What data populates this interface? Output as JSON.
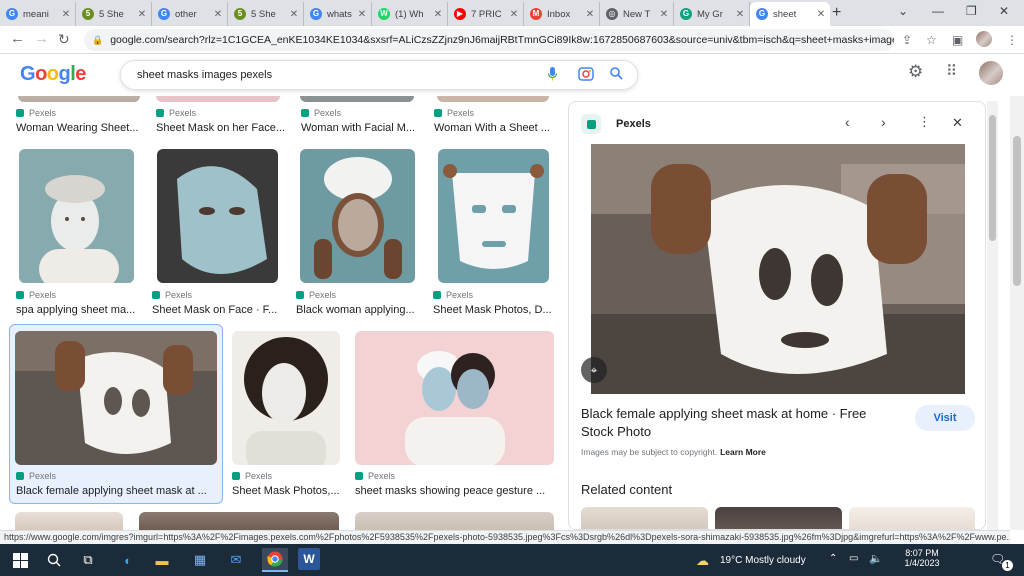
{
  "tabs": [
    {
      "title": "meani",
      "favicon": "G",
      "color": "#4285f4"
    },
    {
      "title": "5 She",
      "favicon": "5",
      "color": "#6b8e23"
    },
    {
      "title": "other",
      "favicon": "G",
      "color": "#4285f4"
    },
    {
      "title": "5 She",
      "favicon": "5",
      "color": "#6b8e23"
    },
    {
      "title": "whats",
      "favicon": "G",
      "color": "#4285f4"
    },
    {
      "title": "(1) Wh",
      "favicon": "W",
      "color": "#25d366"
    },
    {
      "title": "7 PRIC",
      "favicon": "▶",
      "color": "#ff0000"
    },
    {
      "title": "Inbox",
      "favicon": "M",
      "color": "#ea4335"
    },
    {
      "title": "New T",
      "favicon": "◎",
      "color": "#5f6368"
    },
    {
      "title": "My Gr",
      "favicon": "G",
      "color": "#10a37f"
    },
    {
      "title": "sheet",
      "favicon": "G",
      "color": "#4285f4"
    }
  ],
  "url": "google.com/search?rlz=1C1GCEA_enKE1034KE1034&sxsrf=ALiCzsZZjnz9nJ6maijRBtTmnGCi89Ik8w:1672850687603&source=univ&tbm=isch&q=sheet+masks+images...",
  "search_query": "sheet masks images pexels",
  "results_row0": [
    {
      "source": "Pexels",
      "caption": "Woman Wearing Sheet..."
    },
    {
      "source": "Pexels",
      "caption": "Sheet Mask on her Face..."
    },
    {
      "source": "Pexels",
      "caption": "Woman with Facial M..."
    },
    {
      "source": "Pexels",
      "caption": "Woman With a Sheet ..."
    }
  ],
  "results_row1": [
    {
      "source": "Pexels",
      "caption": "spa applying sheet ma..."
    },
    {
      "source": "Pexels",
      "caption": "Sheet Mask on Face · F..."
    },
    {
      "source": "Pexels",
      "caption": "Black woman applying..."
    },
    {
      "source": "Pexels",
      "caption": "Sheet Mask Photos, D..."
    }
  ],
  "results_row2": [
    {
      "source": "Pexels",
      "caption": "Black female applying sheet mask at ..."
    },
    {
      "source": "Pexels",
      "caption": "Sheet Mask Photos,..."
    },
    {
      "source": "Pexels",
      "caption": "sheet masks showing peace gesture ..."
    }
  ],
  "panel": {
    "source": "Pexels",
    "title": "Black female applying sheet mask at home · Free Stock Photo",
    "visit": "Visit",
    "copyright": "Images may be subject to copyright.",
    "learn_more": "Learn More",
    "related": "Related content"
  },
  "status_url": "https://www.google.com/imgres?imgurl=https%3A%2F%2Fimages.pexels.com%2Fphotos%2F5938535%2Fpexels-photo-5938535.jpeg%3Fcs%3Dsrgb%26dl%3Dpexels-sora-shimazaki-5938535.jpg%26fm%3Djpg&imgrefurl=https%3A%2F%2Fwww.pe...",
  "taskbar": {
    "weather": "19°C  Mostly cloudy",
    "time": "8:07 PM",
    "date": "1/4/2023",
    "notifications": "1"
  }
}
